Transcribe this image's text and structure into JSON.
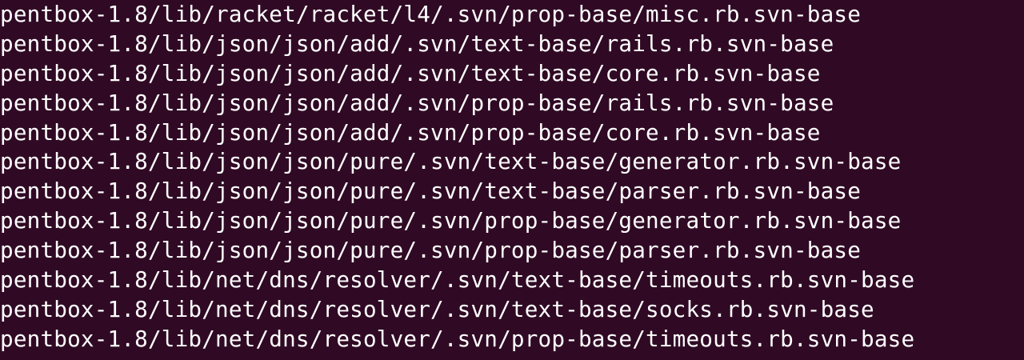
{
  "terminal": {
    "lines": [
      "pentbox-1.8/lib/racket/racket/l4/.svn/prop-base/misc.rb.svn-base",
      "pentbox-1.8/lib/json/json/add/.svn/text-base/rails.rb.svn-base",
      "pentbox-1.8/lib/json/json/add/.svn/text-base/core.rb.svn-base",
      "pentbox-1.8/lib/json/json/add/.svn/prop-base/rails.rb.svn-base",
      "pentbox-1.8/lib/json/json/add/.svn/prop-base/core.rb.svn-base",
      "pentbox-1.8/lib/json/json/pure/.svn/text-base/generator.rb.svn-base",
      "pentbox-1.8/lib/json/json/pure/.svn/text-base/parser.rb.svn-base",
      "pentbox-1.8/lib/json/json/pure/.svn/prop-base/generator.rb.svn-base",
      "pentbox-1.8/lib/json/json/pure/.svn/prop-base/parser.rb.svn-base",
      "pentbox-1.8/lib/net/dns/resolver/.svn/text-base/timeouts.rb.svn-base",
      "pentbox-1.8/lib/net/dns/resolver/.svn/text-base/socks.rb.svn-base",
      "pentbox-1.8/lib/net/dns/resolver/.svn/prop-base/timeouts.rb.svn-base"
    ]
  }
}
